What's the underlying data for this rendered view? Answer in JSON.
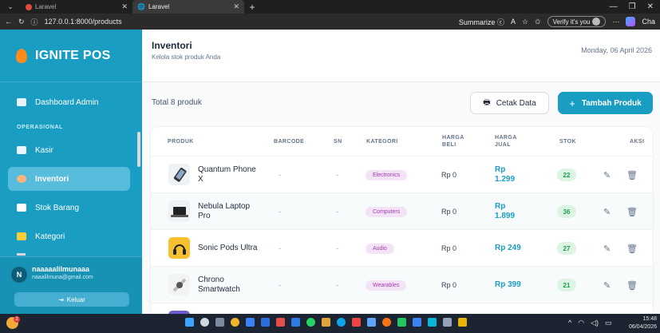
{
  "browser": {
    "tabs": [
      {
        "title": "Laravel"
      },
      {
        "title": "Laravel"
      }
    ],
    "url": "127.0.0.1:8000/products",
    "summarize_label": "Summarize",
    "verify_label": "Verify it's you",
    "more_label": "···",
    "copilot_label": "Cha"
  },
  "sidebar": {
    "brand": "IGNITE POS",
    "items_top": [
      {
        "label": "Dashboard Admin",
        "icon": "dashboard-icon",
        "color": "#e9f2ff"
      }
    ],
    "section_label": "OPERASIONAL",
    "items": [
      {
        "label": "Kasir",
        "icon": "cashier-icon",
        "color": "#eef5ff"
      },
      {
        "label": "Inventori",
        "icon": "inventory-icon",
        "color": "#ffb47a",
        "active": true
      },
      {
        "label": "Stok Barang",
        "icon": "stock-icon",
        "color": "#ffffff"
      },
      {
        "label": "Kategori",
        "icon": "folder-icon",
        "color": "#ffcc33"
      }
    ],
    "user": {
      "initial": "N",
      "name": "naaaaalilmunaaa",
      "email": "naaalilmuna@gmail.com"
    },
    "logout_label": "Keluar"
  },
  "header": {
    "title": "Inventori",
    "subtitle": "Kelola stok produk Anda",
    "date": "Monday, 06 April 2026"
  },
  "toolbar": {
    "total": "Total 8 produk",
    "print_label": "Cetak Data",
    "add_label": "Tambah Produk"
  },
  "table": {
    "columns": [
      "PRODUK",
      "BARCODE",
      "SN",
      "KATEGORI",
      "HARGA BELI",
      "HARGA JUAL",
      "STOK",
      "AKSI"
    ],
    "rows": [
      {
        "name": "Quantum Phone X",
        "barcode": "-",
        "sn": "-",
        "category": "Electronics",
        "buy": "Rp 0",
        "sell": "Rp 1.299",
        "stock": "22",
        "thumb": "phone"
      },
      {
        "name": "Nebula Laptop Pro",
        "barcode": "-",
        "sn": "-",
        "category": "Computers",
        "buy": "Rp 0",
        "sell": "Rp 1.899",
        "stock": "36",
        "thumb": "laptop"
      },
      {
        "name": "Sonic Pods Ultra",
        "barcode": "-",
        "sn": "-",
        "category": "Audio",
        "buy": "Rp 0",
        "sell": "Rp 249",
        "stock": "27",
        "thumb": "headphones"
      },
      {
        "name": "Chrono Smartwatch",
        "barcode": "-",
        "sn": "-",
        "category": "Wearables",
        "buy": "Rp 0",
        "sell": "Rp 399",
        "stock": "21",
        "thumb": "watch"
      }
    ]
  },
  "taskbar": {
    "time": "15:48",
    "date": "06/04/2026",
    "notification_count": "2"
  },
  "colors": {
    "accent": "#1a9dc2",
    "sidebar": "#1a9dc2",
    "stock_badge": "#dcf4e4",
    "category_badge": "#f3e3f7"
  }
}
